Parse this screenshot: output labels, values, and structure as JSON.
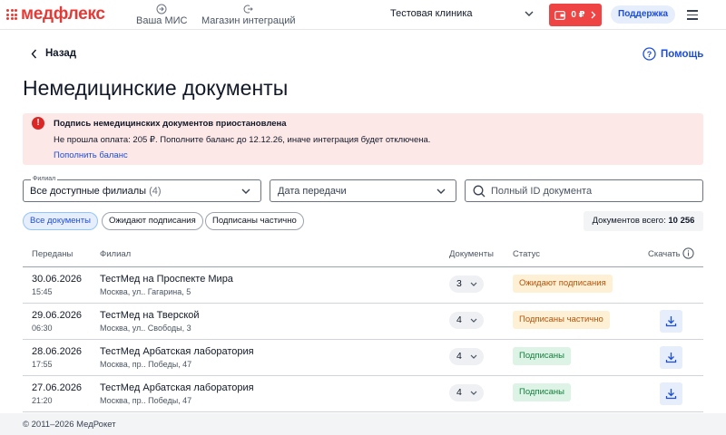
{
  "header": {
    "logo_text": "медфлекс",
    "nav": [
      {
        "label": "Ваша МИС",
        "icon": "login-icon"
      },
      {
        "label": "Магазин интеграций",
        "icon": "exit-icon"
      }
    ],
    "clinic": "Тестовая клиника",
    "balance": "0 ₽",
    "support": "Поддержка"
  },
  "page": {
    "back": "Назад",
    "help": "Помощь",
    "title": "Немедицинские документы"
  },
  "alert": {
    "title": "Подпись немедицинских документов приостановлена",
    "text": "Не прошла оплата: 205 ₽. Пополните баланс до 12.12.26, иначе интеграция будет отключена.",
    "link": "Пополнить баланс",
    "color": "#fde8e8"
  },
  "filters": {
    "branch_label": "Филиал",
    "branch_value": "Все доступные филиалы",
    "branch_count": "(4)",
    "date_placeholder": "Дата передачи",
    "search_placeholder": "Полный ID документа"
  },
  "chips": [
    "Все документы",
    "Ожидают подписания",
    "Подписаны частично"
  ],
  "total": {
    "label": "Документов всего:",
    "value": "10 256"
  },
  "table": {
    "headers": {
      "sent": "Переданы",
      "branch": "Филиал",
      "docs": "Документы",
      "status": "Статус",
      "download": "Скачать"
    },
    "rows": [
      {
        "date": "30.06.2026",
        "time": "15:45",
        "name": "ТестМед на Проспекте Мира",
        "address": "Москва, ул.. Гагарина, 5",
        "docs": "3",
        "status": "Ожидают подписания",
        "status_kind": "wait",
        "download": false
      },
      {
        "date": "29.06.2026",
        "time": "06:30",
        "name": "ТестМед на Тверской",
        "address": "Москва, ул.. Свободы, 3",
        "docs": "4",
        "status": "Подписаны частично",
        "status_kind": "part",
        "download": true
      },
      {
        "date": "28.06.2026",
        "time": "17:55",
        "name": "ТестМед Арбатская лаборатория",
        "address": "Москва, пр.. Победы, 47",
        "docs": "4",
        "status": "Подписаны",
        "status_kind": "ok",
        "download": true
      },
      {
        "date": "27.06.2026",
        "time": "21:20",
        "name": "ТестМед Арбатская лаборатория",
        "address": "Москва, пр.. Победы, 47",
        "docs": "4",
        "status": "Подписаны",
        "status_kind": "ok",
        "download": true
      }
    ]
  },
  "footer": "© 2011–2026 МедРокет",
  "colors": {
    "brand": "#e53935",
    "accent": "#1d4ed8",
    "danger": "#ef4444"
  }
}
